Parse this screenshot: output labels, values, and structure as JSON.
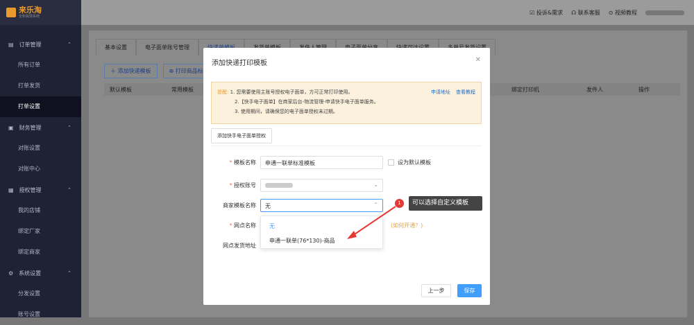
{
  "app": {
    "logo": "来乐淘",
    "logo_sub": "全新跨境系统"
  },
  "topbar": {
    "items": [
      "投诉&需求",
      "联系客服",
      "视频教程"
    ]
  },
  "sidebar": {
    "groups": [
      {
        "label": "订单管理",
        "items": [
          "所有订单",
          "打单发货",
          "打单设置"
        ]
      },
      {
        "label": "财务管理",
        "items": [
          "对账设置",
          "对账中心"
        ]
      },
      {
        "label": "授权管理",
        "items": [
          "我的店铺",
          "绑定厂家",
          "绑定商家"
        ]
      },
      {
        "label": "系统设置",
        "items": [
          "分发设置",
          "账号设置"
        ]
      }
    ]
  },
  "page": {
    "tabs": [
      "基本设置",
      "电子面单账号管理",
      "快递单模板",
      "发货单模板",
      "发件人管理",
      "电子面单分享",
      "快递可达设置",
      "多单号发货设置"
    ],
    "toolbar": [
      "＋ 添加快递模板",
      "⊕ 打印商品标"
    ],
    "columns": [
      "默认模板",
      "常用模板",
      "绑定打印机",
      "发件人",
      "操作"
    ]
  },
  "modal": {
    "title": "添加快递打印模板",
    "alert": {
      "tip_label": "提醒:",
      "lines": [
        "1. 您需要使用主账号授权电子面单，方可正常打印使用。",
        "2.【快手电子面单】在商家后台-物流管理-申请快手电子面单服务。",
        "3. 使用期间，请确保您的电子面单授权未过期。"
      ],
      "links": [
        "申请地址",
        "查看教程"
      ]
    },
    "auth_button": "添加快手电子面单授权",
    "fields": {
      "template_name_label": "模板名称",
      "template_name_value": "申通一联单标准模板",
      "default_checkbox_label": "设为默认模板",
      "auth_account_label": "授权账号",
      "merchant_template_label": "商家模板名称",
      "merchant_template_value": "无",
      "outlet_name_label": "网点名称",
      "outlet_help": "(如何开通？)",
      "outlet_address_label": "网点发货地址"
    },
    "dropdown_options": [
      "无",
      "申通一联单(76*130)-商品"
    ],
    "buttons": {
      "prev": "上一步",
      "save": "保存"
    }
  },
  "callout": {
    "number": "1",
    "text": "可以选择自定义模板"
  }
}
